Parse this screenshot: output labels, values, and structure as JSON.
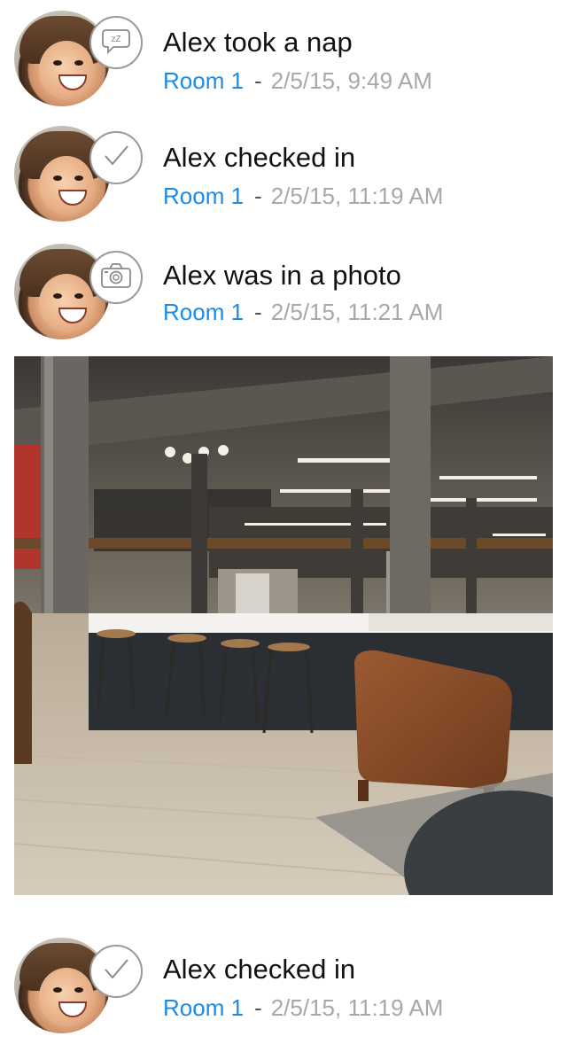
{
  "feed": {
    "items": [
      {
        "title": "Alex took a nap",
        "room": "Room 1",
        "separator": "-",
        "timestamp": "2/5/15, 9:49 AM",
        "icon": "zz-nap-icon"
      },
      {
        "title": "Alex checked in",
        "room": "Room 1",
        "separator": "-",
        "timestamp": "2/5/15, 11:19 AM",
        "icon": "checkmark-icon"
      },
      {
        "title": "Alex was in a photo",
        "room": "Room 1",
        "separator": "-",
        "timestamp": "2/5/15, 11:21 AM",
        "icon": "camera-icon"
      },
      {
        "title": "Alex checked in",
        "room": "Room 1",
        "separator": "-",
        "timestamp": "2/5/15, 11:19 AM",
        "icon": "checkmark-icon"
      }
    ],
    "colors": {
      "room_link": "#1a8ce8",
      "timestamp": "#a8a8a8",
      "title": "#111111",
      "badge_border": "#9a9a9a"
    },
    "nap_glyph": "zZ"
  }
}
